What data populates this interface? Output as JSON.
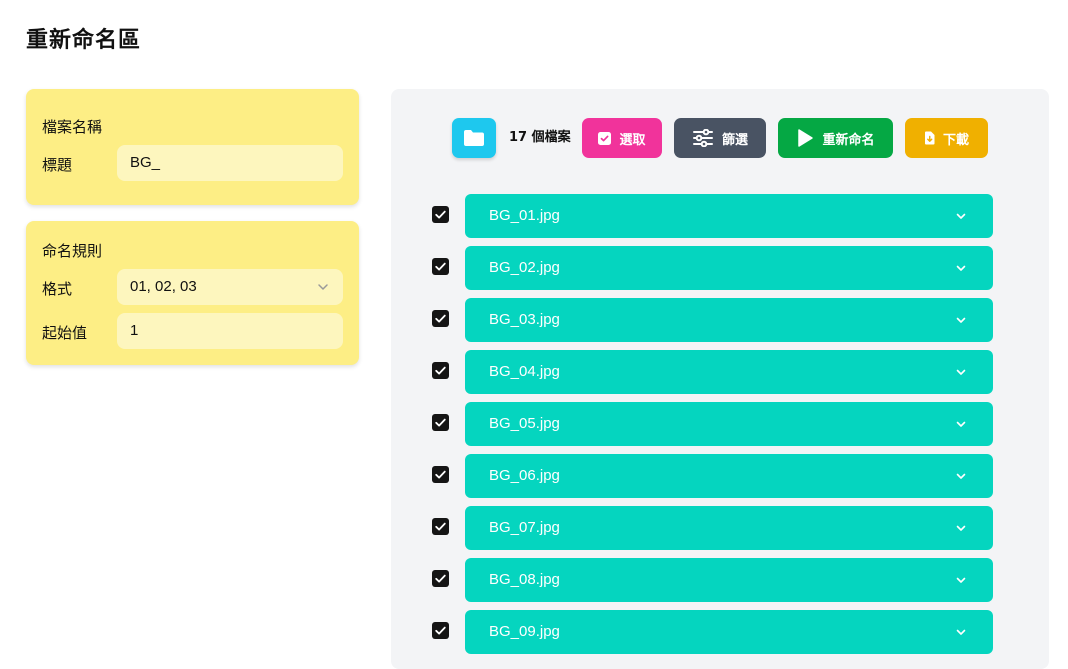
{
  "page": {
    "title": "重新命名區"
  },
  "name_card": {
    "title": "檔案名稱",
    "label": "標題",
    "value": "BG_"
  },
  "rule_card": {
    "title": "命名規則",
    "format_label": "格式",
    "format_value": "01, 02, 03",
    "start_label": "起始值",
    "start_value": "1"
  },
  "toolbar": {
    "folder_icon": "folder-icon",
    "count_text": "17 個檔案",
    "select_label": "選取",
    "filter_label": "篩選",
    "rename_label": "重新命名",
    "download_label": "下載"
  },
  "colors": {
    "card": "#fdee85",
    "folder": "#1ec8ee",
    "select": "#f1339b",
    "filter": "#495363",
    "rename": "#05a844",
    "download": "#f0b000",
    "file_bar": "#05d5bf"
  },
  "files": [
    {
      "name": "BG_01.jpg",
      "checked": true
    },
    {
      "name": "BG_02.jpg",
      "checked": true
    },
    {
      "name": "BG_03.jpg",
      "checked": true
    },
    {
      "name": "BG_04.jpg",
      "checked": true
    },
    {
      "name": "BG_05.jpg",
      "checked": true
    },
    {
      "name": "BG_06.jpg",
      "checked": true
    },
    {
      "name": "BG_07.jpg",
      "checked": true
    },
    {
      "name": "BG_08.jpg",
      "checked": true
    },
    {
      "name": "BG_09.jpg",
      "checked": true
    }
  ]
}
